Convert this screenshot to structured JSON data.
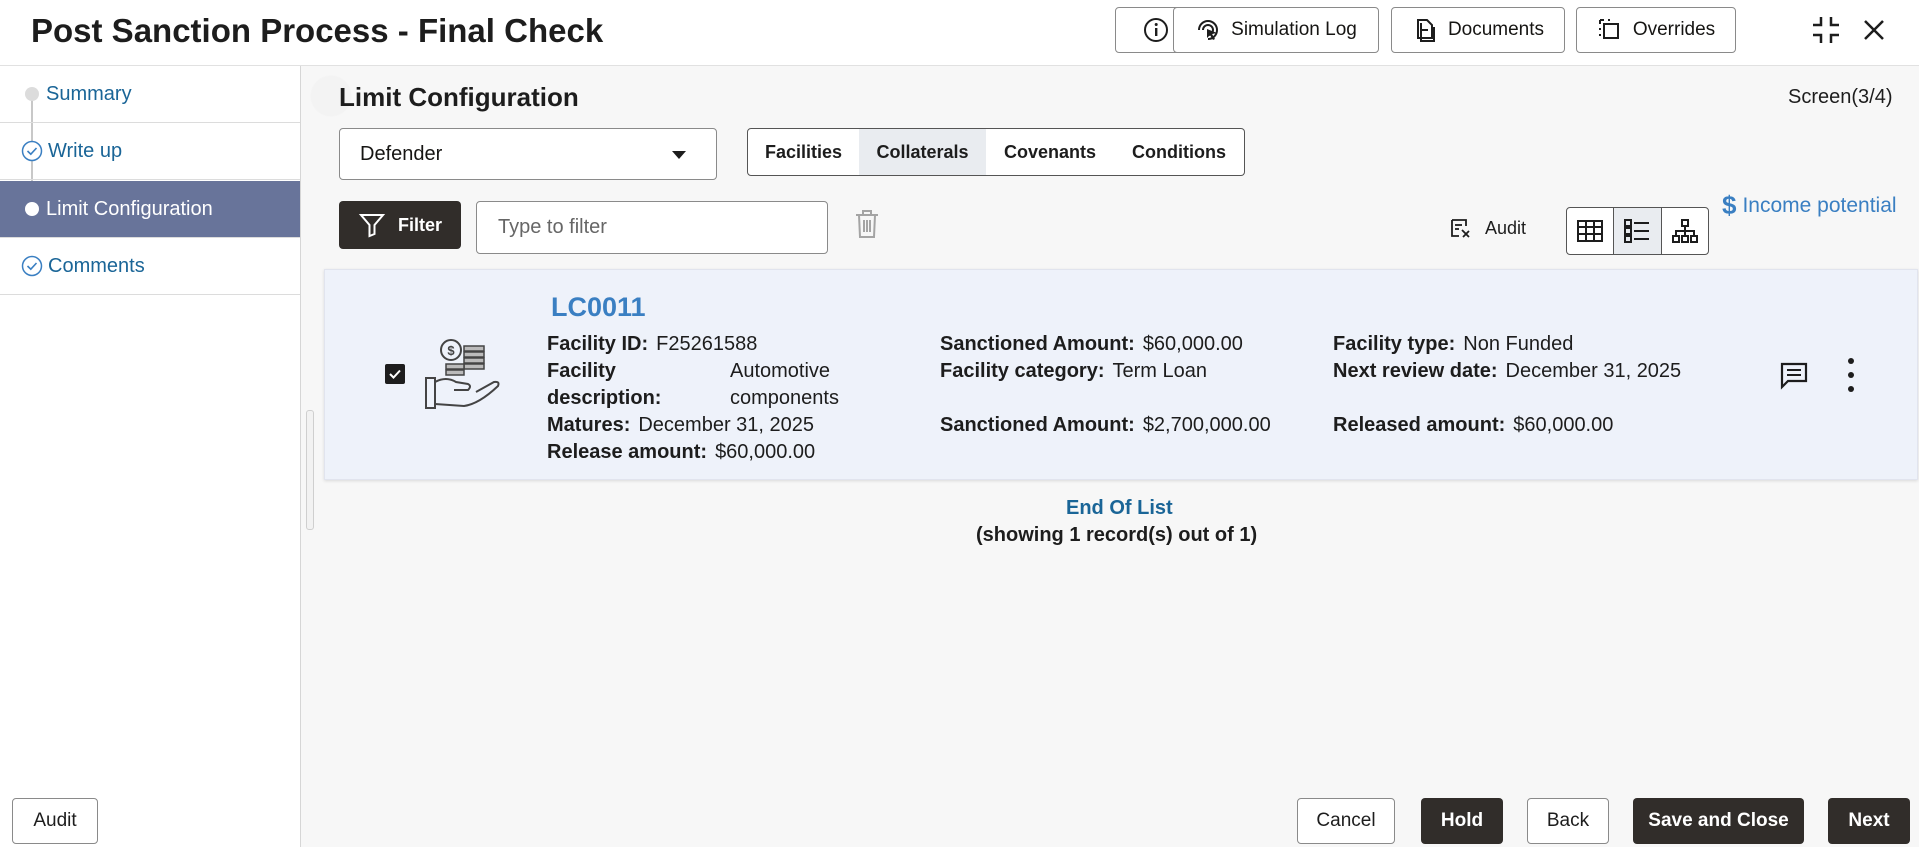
{
  "header": {
    "title": "Post Sanction Process - Final Check",
    "buttons": {
      "simulation_log": "Simulation Log",
      "documents": "Documents",
      "overrides": "Overrides"
    }
  },
  "sidebar": {
    "items": [
      {
        "label": "Summary",
        "state": "pending"
      },
      {
        "label": "Write up",
        "state": "done"
      },
      {
        "label": "Limit Configuration",
        "state": "active"
      },
      {
        "label": "Comments",
        "state": "done"
      }
    ]
  },
  "main": {
    "section_title": "Limit Configuration",
    "screen_count": "Screen(3/4)",
    "party_select": {
      "value": "Defender"
    },
    "tabs": [
      {
        "label": "Facilities",
        "selected": false
      },
      {
        "label": "Collaterals",
        "selected": true
      },
      {
        "label": "Covenants",
        "selected": false
      },
      {
        "label": "Conditions",
        "selected": false
      }
    ],
    "filter_button": "Filter",
    "filter_placeholder": "Type to filter",
    "income_potential": "Income potential",
    "income_symbol": "$",
    "audit_label": "Audit"
  },
  "card": {
    "title": "LC0011",
    "facility_id_label": "Facility ID:",
    "facility_id": "F25261588",
    "facility_desc_label_1": "Facility",
    "facility_desc_label_2": "description:",
    "facility_desc_1": "Automotive",
    "facility_desc_2": "components",
    "matures_label": "Matures:",
    "matures": "December 31, 2025",
    "release_amount_label": "Release amount:",
    "release_amount": "$60,000.00",
    "sanctioned_amount_label": "Sanctioned Amount:",
    "sanctioned_amount": "$60,000.00",
    "facility_category_label": "Facility category:",
    "facility_category": "Term Loan",
    "sanctioned_amount_2_label": "Sanctioned Amount:",
    "sanctioned_amount_2": "$2,700,000.00",
    "facility_type_label": "Facility type:",
    "facility_type": "Non Funded",
    "next_review_label": "Next review date:",
    "next_review": "December 31, 2025",
    "released_amount_label": "Released amount:",
    "released_amount": "$60,000.00"
  },
  "list": {
    "end_of_list": "End Of List",
    "showing": "(showing 1 record(s) out of 1)"
  },
  "footer": {
    "audit": "Audit",
    "cancel": "Cancel",
    "hold": "Hold",
    "back": "Back",
    "save_and_close": "Save and Close",
    "next": "Next"
  }
}
